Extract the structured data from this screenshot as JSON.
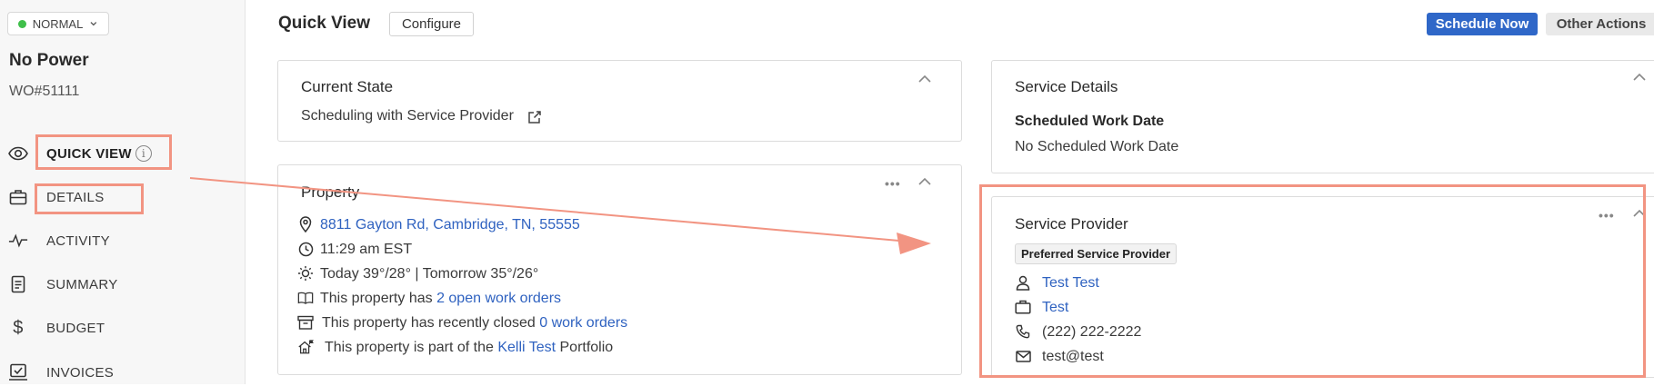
{
  "sidebar": {
    "status": "NORMAL",
    "title": "No Power",
    "wo_number": "WO#51111",
    "nav": [
      {
        "label": "QUICK VIEW",
        "icon": "eye-icon"
      },
      {
        "label": "DETAILS",
        "icon": "briefcase-icon"
      },
      {
        "label": "ACTIVITY",
        "icon": "activity-icon"
      },
      {
        "label": "SUMMARY",
        "icon": "document-icon"
      },
      {
        "label": "BUDGET",
        "icon": "dollar-icon"
      },
      {
        "label": "INVOICES",
        "icon": "invoice-icon"
      }
    ]
  },
  "header": {
    "title": "Quick View",
    "configure": "Configure",
    "schedule_now": "Schedule Now",
    "other_actions": "Other Actions"
  },
  "current_state": {
    "title": "Current State",
    "value": "Scheduling with Service Provider"
  },
  "property": {
    "title": "Property",
    "address": "8811 Gayton Rd, Cambridge, TN, 55555",
    "time": "11:29 am EST",
    "weather": "Today 39°/28° | Tomorrow 35°/26°",
    "open_prefix": "This property has ",
    "open_link": "2 open work orders",
    "closed_prefix": "This property has recently closed ",
    "closed_link": "0 work orders",
    "portfolio_prefix": "This property is part of the ",
    "portfolio_link": "Kelli Test",
    "portfolio_suffix": " Portfolio"
  },
  "service_details": {
    "title": "Service Details",
    "label": "Scheduled Work Date",
    "value": "No Scheduled Work Date"
  },
  "service_provider": {
    "title": "Service Provider",
    "badge": "Preferred Service Provider",
    "contact_name": "Test Test",
    "company": "Test",
    "phone": "(222) 222-2222",
    "email": "test@test"
  },
  "colors": {
    "accent": "#2f67c8",
    "link": "#2f62c0",
    "highlight": "#f29482",
    "status_ok": "#3fbf4a"
  }
}
